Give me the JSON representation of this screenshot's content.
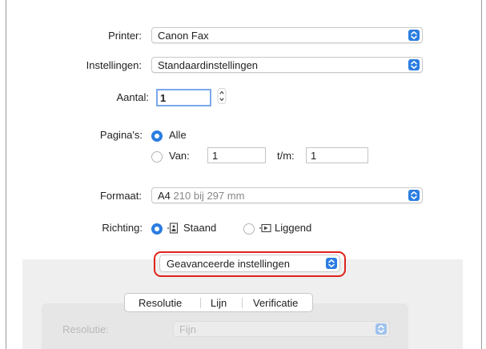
{
  "printer": {
    "label": "Printer:",
    "value": "Canon Fax"
  },
  "settings": {
    "label": "Instellingen:",
    "value": "Standaardinstellingen"
  },
  "copies": {
    "label": "Aantal:",
    "value": "1"
  },
  "pages": {
    "label": "Pagina's:",
    "all_label": "Alle",
    "from_label": "Van:",
    "from_value": "1",
    "to_label": "t/m:",
    "to_value": "1"
  },
  "format": {
    "label": "Formaat:",
    "name": "A4",
    "size": "210 bij 297 mm"
  },
  "orientation": {
    "label": "Richting:",
    "portrait": "Staand",
    "landscape": "Liggend"
  },
  "advanced": {
    "label": "Geavanceerde instellingen"
  },
  "tabs": [
    {
      "label": "Resolutie"
    },
    {
      "label": "Lijn"
    },
    {
      "label": "Verificatie"
    }
  ],
  "resolution": {
    "label": "Resolutie:",
    "value": "Fijn"
  },
  "colors": {
    "accent": "#2a7de1",
    "highlight": "#e0231b"
  }
}
